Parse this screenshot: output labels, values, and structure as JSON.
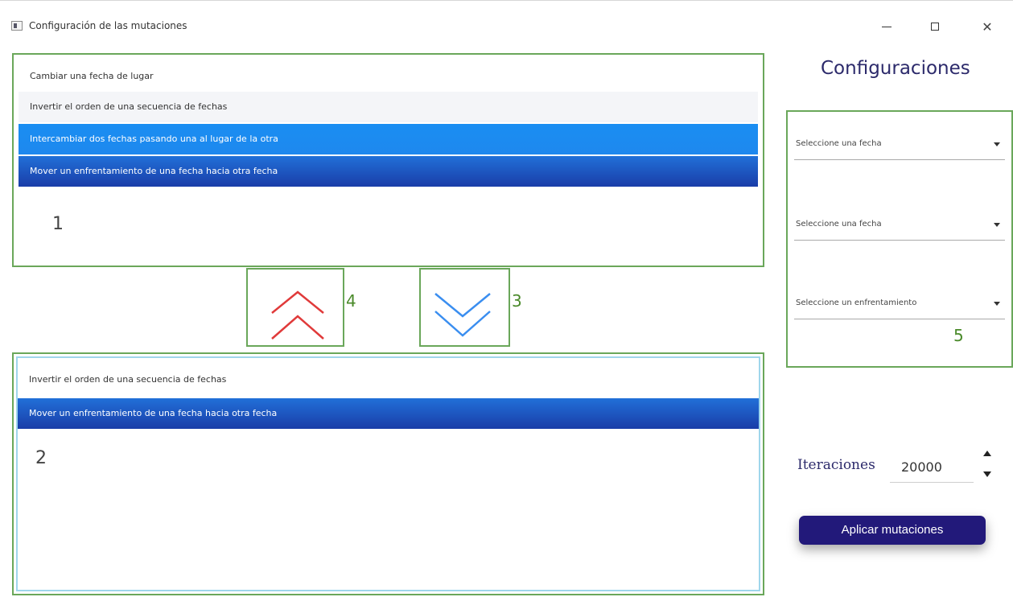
{
  "window": {
    "title": "Configuración de las mutaciones"
  },
  "list1": {
    "items": [
      "Cambiar una fecha de lugar",
      "Invertir el orden de una secuencia de fechas",
      "Intercambiar dos fechas pasando una al lugar de la otra",
      "Mover un enfrentamiento de una fecha hacia otra fecha"
    ],
    "annotation": "1"
  },
  "list2": {
    "items": [
      "Invertir el orden de una secuencia de fechas",
      "Mover un enfrentamiento de una fecha hacia otra fecha"
    ],
    "annotation": "2"
  },
  "buttons": {
    "up_annotation": "4",
    "down_annotation": "3",
    "up_color": "#e03a3a",
    "down_color": "#3a8ef0"
  },
  "config": {
    "title": "Configuraciones",
    "combos": [
      "Seleccione una fecha",
      "Seleccione una fecha",
      "Seleccione un enfrentamiento"
    ],
    "annotation": "5"
  },
  "iterations": {
    "label": "Iteraciones",
    "value": "20000"
  },
  "apply_label": "Aplicar mutaciones",
  "colors": {
    "border_green": "#6aa75a",
    "accent_navy": "#22197a",
    "selection_blue": "#1e88ee"
  }
}
